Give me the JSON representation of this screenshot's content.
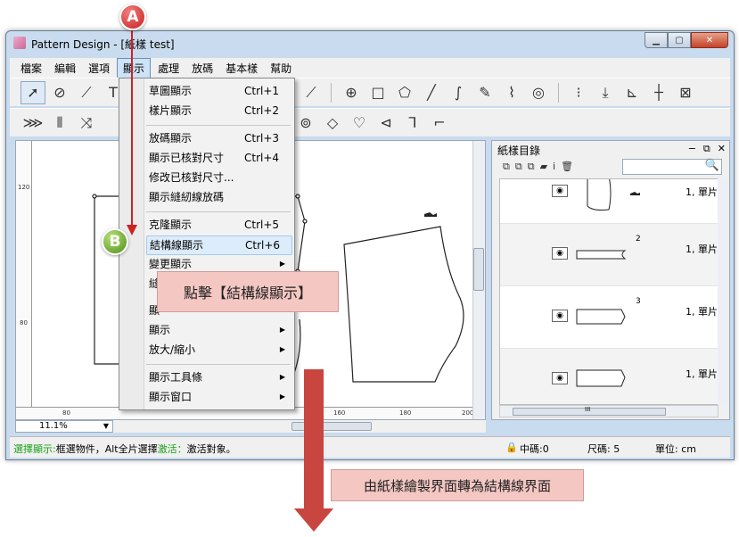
{
  "window": {
    "title": "Pattern Design - [紙樣 test]",
    "controls": {
      "minimize": "▁",
      "maximize": "▢",
      "close": "✕"
    }
  },
  "menubar": {
    "items": [
      "檔案",
      "編輯",
      "選項",
      "顯示",
      "處理",
      "放碼",
      "基本樣",
      "幫助"
    ],
    "active": "顯示"
  },
  "toolbar1_icons": [
    "select-arrow-icon",
    "zoom-icon",
    "ruler-icon",
    "text-icon",
    "dropdown-icon",
    "grid-icon",
    "circle-target-icon",
    "square-icon",
    "hexagon-icon",
    "line-icon",
    "curve-icon",
    "edit-check-icon",
    "scissor-line-icon",
    "spiral-icon",
    "vertical-dots-icon",
    "down-arrow-icon",
    "axis-icon",
    "dash-cross-icon",
    "box-cross-icon"
  ],
  "toolbar2_icons": [
    "dart-icon",
    "columns-icon",
    "rotate-icon",
    "notch-icon",
    "diamond-icon",
    "fold-icon",
    "shape-icon",
    "corner-icon",
    "bracket-icon"
  ],
  "dropdown": {
    "items": [
      {
        "label": "草圖顯示",
        "shortcut": "Ctrl+1"
      },
      {
        "label": "樣片顯示",
        "shortcut": "Ctrl+2"
      },
      {
        "label": "放碼顯示",
        "shortcut": "Ctrl+3"
      },
      {
        "label": "顯示已核對尺寸",
        "shortcut": "Ctrl+4"
      },
      {
        "label": "修改已核對尺寸...",
        "shortcut": ""
      },
      {
        "label": "顯示縫紉線放碼",
        "shortcut": ""
      },
      {
        "label": "克隆顯示",
        "shortcut": "Ctrl+5"
      },
      {
        "label": "結構線顯示",
        "shortcut": "Ctrl+6"
      },
      {
        "label": "變更顯示",
        "shortcut": ""
      },
      {
        "label": "顯示",
        "shortcut": ""
      },
      {
        "label": "放大/縮小",
        "shortcut": ""
      },
      {
        "label": "顯示工具條",
        "shortcut": ""
      },
      {
        "label": "顯示窗口",
        "shortcut": ""
      }
    ],
    "partial_labels": [
      "縫",
      "顯"
    ],
    "submenu_arrow": "▶"
  },
  "ruler": {
    "v_labels": [
      "120",
      "80"
    ],
    "h_labels": [
      "80",
      "160",
      "180",
      "200"
    ]
  },
  "zoom": {
    "value": "11.1%"
  },
  "panel": {
    "title": "紙樣目錄",
    "controls": [
      "−",
      "⧉",
      "✕"
    ],
    "tool_glyphs": [
      "⧉",
      "⧉",
      "⧉",
      "▰",
      "i",
      "🗑"
    ],
    "search_glyph": "🔍",
    "pieces": [
      {
        "num": "",
        "count": "1, 單片"
      },
      {
        "num": "2",
        "count": "1, 單片"
      },
      {
        "num": "3",
        "count": "1, 單片"
      },
      {
        "num": "",
        "count": "1, 單片"
      }
    ],
    "hscroll_glyph": "III"
  },
  "status": {
    "left_green1": "選擇顯示:",
    "left_text1": "框選物件，Alt全片選擇",
    "left_green2": "激活：",
    "left_text2": "激活對象。",
    "lock_icon": "🔒",
    "code": "中碼:0",
    "size": "尺碼: 5",
    "unit": "單位: cm"
  },
  "annotations": {
    "badge_a": "A",
    "badge_b": "B",
    "callout1": "點擊【結構線顯示】",
    "callout2": "由紙樣繪製界面轉為結構線界面"
  },
  "colors": {
    "accent_red": "#d02020",
    "callout_bg": "#f4c7c3",
    "badge_green": "#4c8f17",
    "status_green": "#1aa21a"
  }
}
